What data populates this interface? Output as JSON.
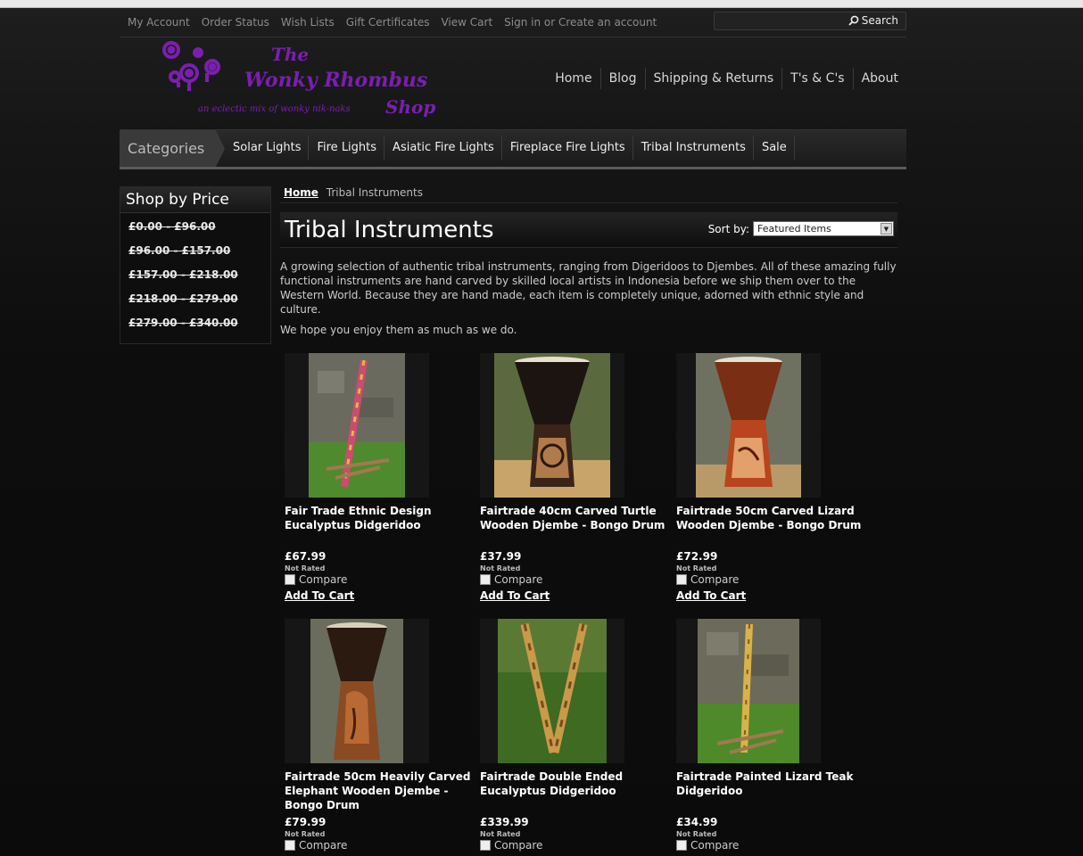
{
  "top_links": [
    "My Account",
    "Order Status",
    "Wish Lists",
    "Gift Certificates",
    "View Cart",
    "Sign in or Create an account"
  ],
  "search": {
    "button_label": "Search",
    "placeholder": ""
  },
  "logo": {
    "line1": "The",
    "line2": "Wonky Rhombus",
    "line3": "Shop",
    "tagline": "an eclectic mix of wonky nik-naks"
  },
  "main_nav": [
    "Home",
    "Blog",
    "Shipping & Returns",
    "T's & C's",
    "About"
  ],
  "categories": {
    "label": "Categories",
    "items": [
      "Solar Lights",
      "Fire Lights",
      "Asiatic Fire Lights",
      "Fireplace Fire Lights",
      "Tribal Instruments",
      "Sale"
    ]
  },
  "sidebar": {
    "title": "Shop by Price",
    "ranges": [
      "£0.00 - £96.00",
      "£96.00 - £157.00",
      "£157.00 - £218.00",
      "£218.00 - £279.00",
      "£279.00 - £340.00"
    ]
  },
  "breadcrumb": {
    "home": "Home",
    "current": "Tribal Instruments"
  },
  "page_title": "Tribal Instruments",
  "sort": {
    "label": "Sort by:",
    "selected": "Featured Items"
  },
  "description": [
    "A growing selection of authentic tribal instruments, ranging from Digeridoos to Djembes. All of these amazing fully functional instruments are hand carved by skilled local artists in Indonesia before we ship them over to the Western World. Because they are hand made, each item is completely unique, adorned with ethnic style and culture.",
    "We hope you enjoy them as much as we do."
  ],
  "product_labels": {
    "rating": "Not Rated",
    "compare": "Compare",
    "add_to_cart": "Add To Cart"
  },
  "products": [
    {
      "name": "Fair Trade Ethnic Design Eucalyptus Didgeridoo",
      "price": "£67.99",
      "image": "didgeridoo-icon"
    },
    {
      "name": "Fairtrade 40cm Carved Turtle Wooden Djembe - Bongo Drum",
      "price": "£37.99",
      "image": "djembe-icon"
    },
    {
      "name": "Fairtrade 50cm Carved Lizard Wooden Djembe - Bongo Drum",
      "price": "£72.99",
      "image": "djembe-icon"
    },
    {
      "name": "Fairtrade 50cm Heavily Carved Elephant Wooden Djembe - Bongo Drum",
      "price": "£79.99",
      "image": "djembe-icon"
    },
    {
      "name": "Fairtrade Double Ended Eucalyptus Didgeridoo",
      "price": "£339.99",
      "image": "didgeridoo-icon"
    },
    {
      "name": "Fairtrade Painted Lizard Teak Didgeridoo",
      "price": "£34.99",
      "image": "didgeridoo-icon"
    }
  ],
  "colors": {
    "brand_purple": "#7a1fb0",
    "background": "#111111",
    "text": "#dddddd"
  }
}
